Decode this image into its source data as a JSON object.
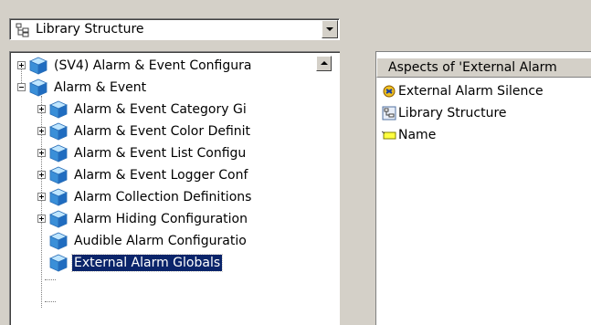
{
  "combo": {
    "label": "Library Structure",
    "icon": "library-structure-icon"
  },
  "tree": {
    "items": [
      {
        "label": "(SV4) Alarm & Event Configura",
        "level": 0,
        "expander": "plus"
      },
      {
        "label": "Alarm & Event",
        "level": 0,
        "expander": "minus"
      },
      {
        "label": "Alarm & Event Category Gi",
        "level": 1,
        "expander": "plus"
      },
      {
        "label": "Alarm & Event Color Definit",
        "level": 1,
        "expander": "plus"
      },
      {
        "label": "Alarm & Event List Configu",
        "level": 1,
        "expander": "plus"
      },
      {
        "label": "Alarm & Event Logger Conf",
        "level": 1,
        "expander": "plus"
      },
      {
        "label": "Alarm Collection Definitions",
        "level": 1,
        "expander": "plus"
      },
      {
        "label": "Alarm Hiding Configuration",
        "level": 1,
        "expander": "plus"
      },
      {
        "label": "Audible Alarm Configuratio",
        "level": 1,
        "expander": "none"
      },
      {
        "label": "External Alarm Globals",
        "level": 1,
        "expander": "none",
        "selected": true
      }
    ]
  },
  "aspects": {
    "header": "Aspects of 'External Alarm",
    "items": [
      {
        "label": "External Alarm Silence",
        "icon": "alarm-silence-icon"
      },
      {
        "label": "Library Structure",
        "icon": "library-structure-icon"
      },
      {
        "label": "Name",
        "icon": "name-tag-icon"
      }
    ]
  },
  "colors": {
    "selection": "#0a246a",
    "panel": "#d4d0c8",
    "cube": "#3a8fd8"
  }
}
